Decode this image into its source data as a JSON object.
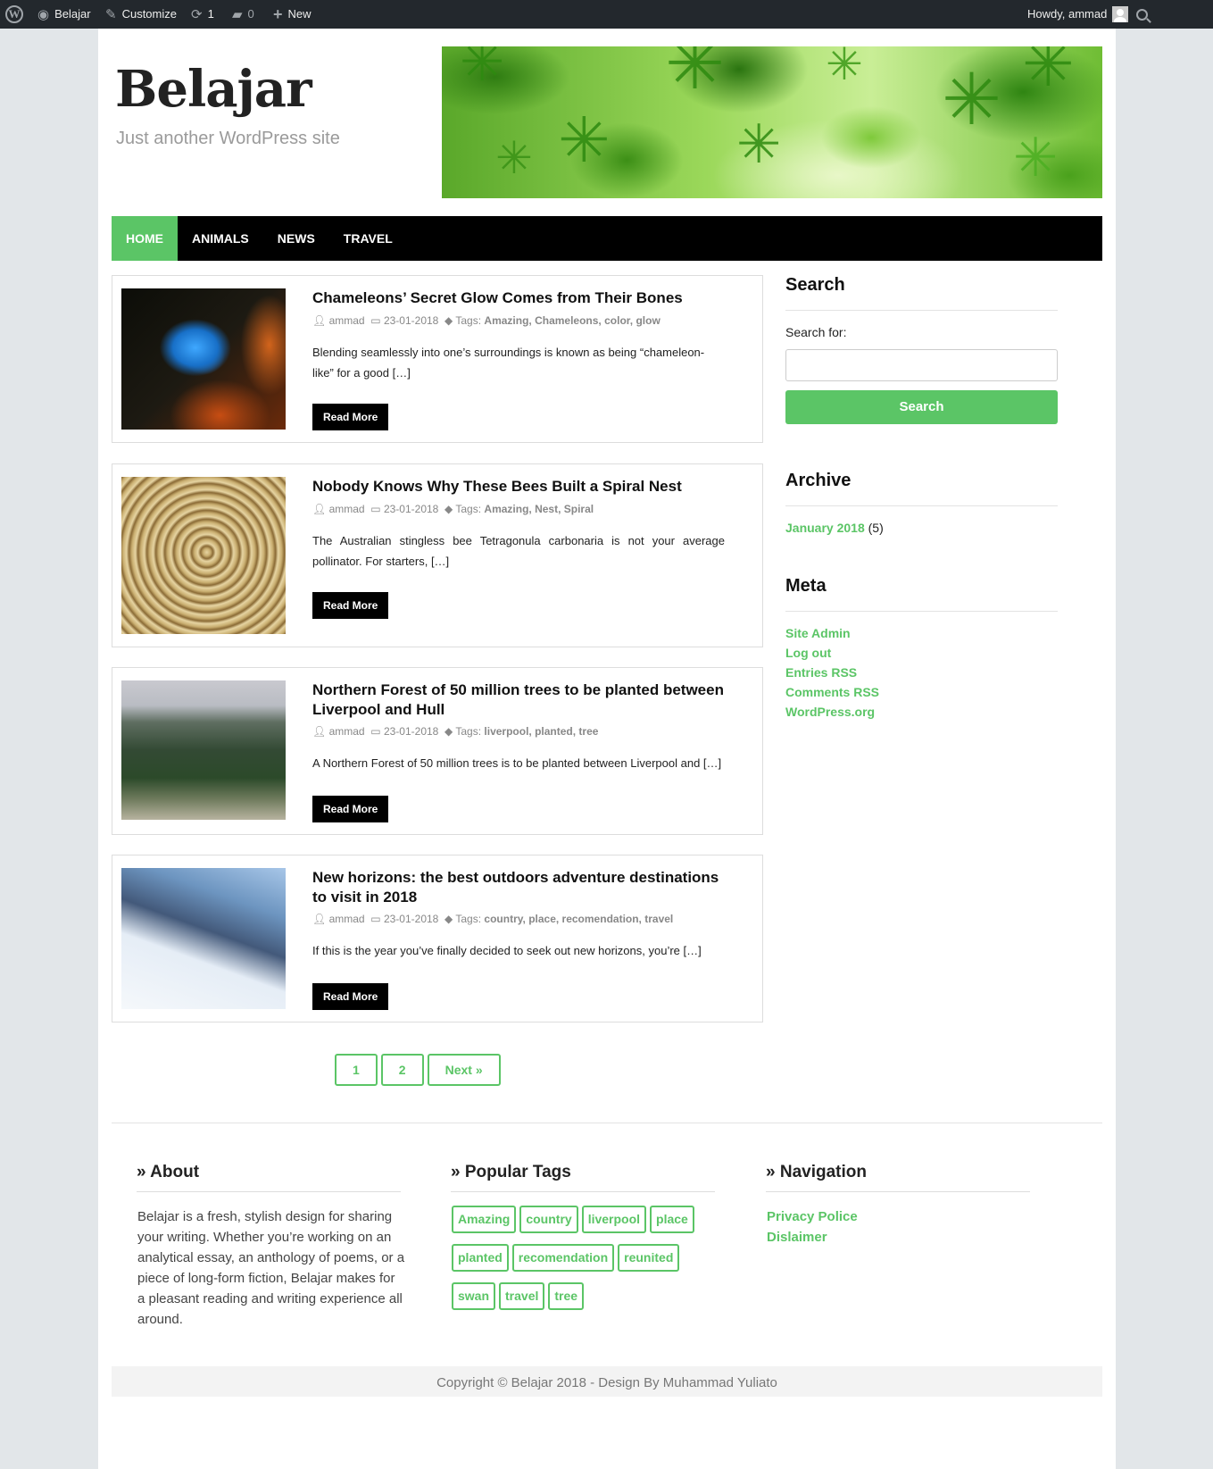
{
  "adminbar": {
    "site": "Belajar",
    "customize": "Customize",
    "updates": "1",
    "comments": "0",
    "new": "New",
    "howdy": "Howdy, ammad"
  },
  "site": {
    "title": "Belajar",
    "description": "Just another WordPress site"
  },
  "nav": [
    "HOME",
    "ANIMALS",
    "NEWS",
    "TRAVEL"
  ],
  "posts": [
    {
      "title": "Chameleons’ Secret Glow Comes from Their Bones",
      "author": "ammad",
      "date": "23-01-2018",
      "tags_label": "Tags:",
      "tags": "Amazing, Chameleons, color, glow",
      "excerpt": "Blending seamlessly into one’s surroundings is known as being “chameleon-like” for a good […]",
      "more": "Read More"
    },
    {
      "title": "Nobody Knows Why These Bees Built a Spiral Nest",
      "author": "ammad",
      "date": "23-01-2018",
      "tags_label": "Tags:",
      "tags": "Amazing, Nest, Spiral",
      "excerpt": "The Australian stingless bee Tetragonula carbonaria is not your average pollinator. For starters, […]",
      "more": "Read More"
    },
    {
      "title": "Northern Forest of 50 million trees to be planted between Liverpool and Hull",
      "author": "ammad",
      "date": "23-01-2018",
      "tags_label": "Tags:",
      "tags": "liverpool, planted, tree",
      "excerpt": "A Northern Forest of 50 million trees is to be planted between Liverpool and […]",
      "more": "Read More"
    },
    {
      "title": "New horizons: the best outdoors adventure destinations to visit in 2018",
      "author": "ammad",
      "date": "23-01-2018",
      "tags_label": "Tags:",
      "tags": "country, place, recomendation, travel",
      "excerpt": "If this is the year you’ve finally decided to seek out new horizons, you’re […]",
      "more": "Read More"
    }
  ],
  "pagination": [
    "1",
    "2",
    "Next »"
  ],
  "sidebar": {
    "search": {
      "title": "Search",
      "label": "Search for:",
      "button": "Search"
    },
    "archive": {
      "title": "Archive",
      "month": "January 2018",
      "count": "(5)"
    },
    "meta": {
      "title": "Meta",
      "links": [
        "Site Admin",
        "Log out",
        "Entries RSS",
        "Comments RSS",
        "WordPress.org"
      ]
    }
  },
  "footer": {
    "about": {
      "title": "About",
      "text": "Belajar is a fresh, stylish design for sharing your writing. Whether you’re working on an analytical essay, an anthology of poems, or a piece of long-form fiction, Belajar makes for a pleasant reading and writing experience all around."
    },
    "tags": {
      "title": "Popular Tags",
      "items": [
        "Amazing",
        "country",
        "liverpool",
        "place",
        "planted",
        "recomendation",
        "reunited",
        "swan",
        "travel",
        "tree"
      ]
    },
    "navigation": {
      "title": "Navigation",
      "links": [
        "Privacy Police",
        "Dislaimer"
      ]
    },
    "copyright": "Copyright © Belajar 2018 - Design By Muhammad Yuliato"
  },
  "colors": {
    "accent": "#5bc566",
    "adminbar": "#23282d",
    "nav": "#000000"
  }
}
